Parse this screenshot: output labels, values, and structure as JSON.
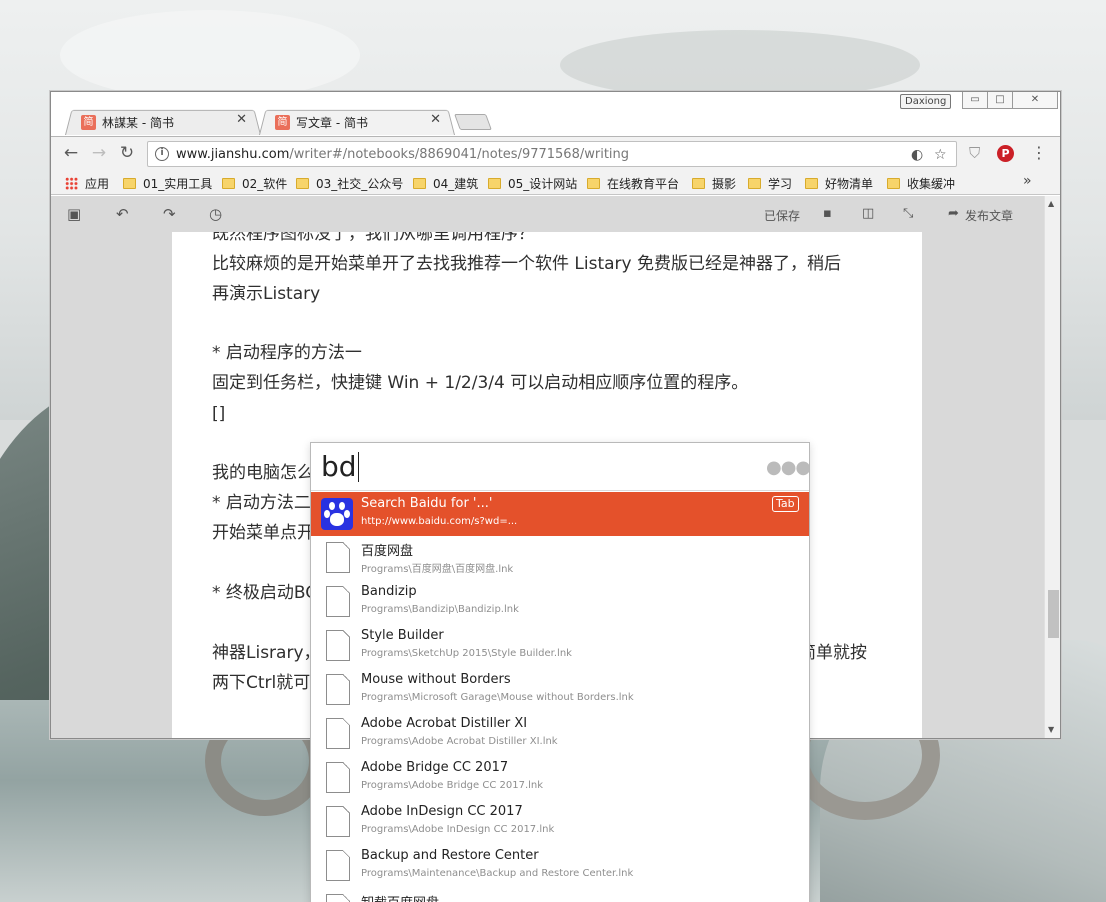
{
  "browser": {
    "profile_name": "Daxiong",
    "window_controls": {
      "minimize": "▭",
      "maximize": "□",
      "close": "✕"
    },
    "tabs": [
      {
        "favicon": "简",
        "title": "林謀某 - 简书",
        "close": "✕"
      },
      {
        "favicon": "简",
        "title": "写文章 - 简书",
        "close": "✕",
        "active": true
      }
    ],
    "url_host": "www.jianshu.com",
    "url_path": "/writer#/notebooks/8869041/notes/9771568/writing",
    "bookmarks": [
      "应用",
      "01_实用工具",
      "02_软件",
      "03_社交_公众号",
      "04_建筑",
      "05_设计网站",
      "在线教育平台",
      "摄影",
      "学习",
      "好物清单",
      "收集缓冲"
    ],
    "bookmarks_more": "»"
  },
  "editor": {
    "saved_label": "已保存",
    "publish_label": "发布文章",
    "lines": [
      "既然程序图标没了，我们从哪里调用程序？",
      "比较麻烦的是开始菜单开了去找我推荐一个软件 Listary 免费版已经是神器了，稍后",
      "再演示Listary",
      "* 启动程序的方法一",
      "固定到任务栏，快捷键 Win + 1/2/3/4 可以启动相应顺序位置的程序。",
      "[]",
      "我的电脑怎么",
      "* 启动方法二",
      "开始菜单点开",
      "* 终极启动BO",
      "神器Lisrary，",
      "简单就按",
      "两下Ctrl就可"
    ]
  },
  "listary": {
    "query": "bd",
    "more_dots": "●●●",
    "results": [
      {
        "name": "Search Baidu for '...'",
        "path": "http://www.baidu.com/s?wd=...",
        "hint": "Tab",
        "selected": true
      },
      {
        "name": "百度网盘",
        "path": "Programs\\百度网盘\\百度网盘.lnk"
      },
      {
        "name": "Bandizip",
        "path": "Programs\\Bandizip\\Bandizip.lnk"
      },
      {
        "name": "Style Builder",
        "path": "Programs\\SketchUp 2015\\Style Builder.lnk"
      },
      {
        "name": "Mouse without Borders",
        "path": "Programs\\Microsoft Garage\\Mouse without Borders.lnk"
      },
      {
        "name": "Adobe Acrobat Distiller XI",
        "path": "Programs\\Adobe Acrobat Distiller XI.lnk"
      },
      {
        "name": "Adobe Bridge CC 2017",
        "path": "Programs\\Adobe Bridge CC 2017.lnk"
      },
      {
        "name": "Adobe InDesign CC 2017",
        "path": "Programs\\Adobe InDesign CC 2017.lnk"
      },
      {
        "name": "Backup and Restore Center",
        "path": "Programs\\Maintenance\\Backup and Restore Center.lnk"
      },
      {
        "name": "卸载百度网盘",
        "path": ""
      }
    ]
  },
  "colors": {
    "listary_selected": "#e4512b",
    "jianshu_brand": "#ea6f5a",
    "baidu_blue": "#2932e1"
  }
}
